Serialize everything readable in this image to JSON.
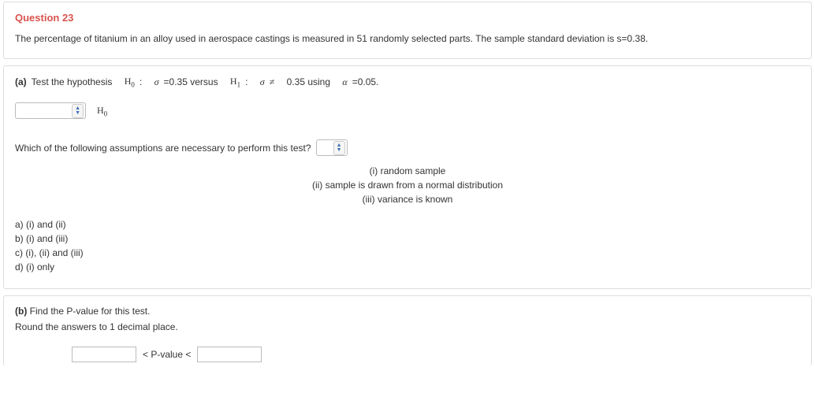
{
  "header": {
    "q_label": "Question 23",
    "prompt": "The percentage of titanium in an alloy used in aerospace castings is measured in 51 randomly selected parts. The sample standard deviation is s=0.38."
  },
  "part_a": {
    "label": "(a)",
    "prefix": "Test the hypothesis",
    "h0_sym": "H",
    "h0_sub": "0",
    "colon": ":",
    "sigma": "σ",
    "eq": "=0.35 versus",
    "h1_sym": "H",
    "h1_sub": "1",
    "neq": "≠",
    "rhs": "0.35 using",
    "alpha": "α",
    "alpha_val": "=0.05.",
    "h0_after_select": "H",
    "h0_after_sub": "0",
    "assumption_q": "Which of the following assumptions are necessary to perform this test?",
    "assump_i": "(i) random sample",
    "assump_ii": "(ii) sample is drawn from a normal distribution",
    "assump_iii": "(iii) variance is known",
    "opt_a": "a) (i) and (ii)",
    "opt_b": "b) (i) and (iii)",
    "opt_c": "c) (i), (ii) and (iii)",
    "opt_d": "d) (i) only"
  },
  "part_b": {
    "label": "(b)",
    "text": "Find the P-value for this test.",
    "round": "Round the answers to 1 decimal place.",
    "pval_label": "< P-value <"
  }
}
